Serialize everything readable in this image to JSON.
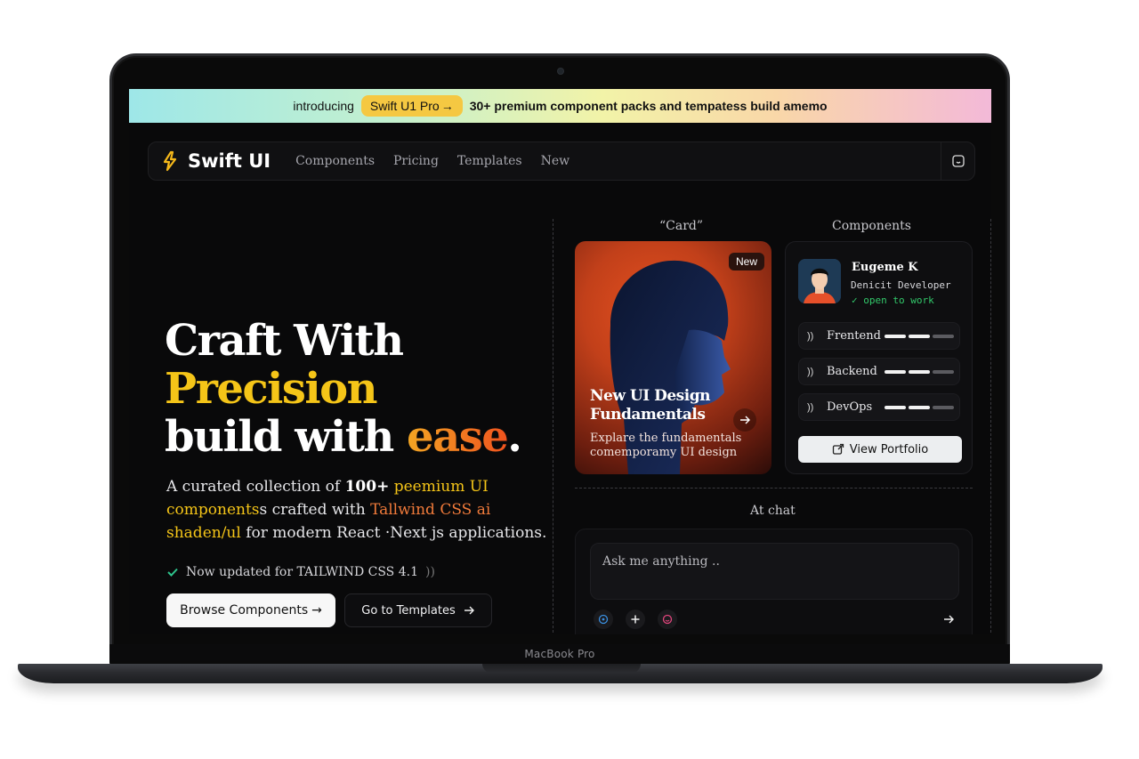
{
  "device": {
    "label": "MacBook Pro"
  },
  "announcement": {
    "prefix": "introducing",
    "pill": "Swift U1 Pro",
    "pill_arrow": "→",
    "text": "30+ premium component packs and tempatess build amemo"
  },
  "nav": {
    "logo": "Swift UI",
    "links": [
      "Components",
      "Pricing",
      "Templates",
      "New"
    ],
    "theme_icon": "theme-toggle-icon"
  },
  "hero": {
    "line1": "Craft With",
    "line2": "Precision",
    "line3a": "build with ",
    "line3b": "ease",
    "line3c": ".",
    "desc": {
      "p1": "A curated collection of ",
      "p2": "100+",
      "p3": " peemium UI",
      "p4": "components",
      "p5": "s crafted with ",
      "p6": "Tallwind CSS ai",
      "p7": "shaden/ul",
      "p8": " for modern React ·Next js applications."
    },
    "updated": "Now updated for TAILWIND CSS 4.1",
    "updated_suffix": "))",
    "browse_btn": "Browse Components",
    "browse_arrow": "→",
    "templates_btn": "Go to Templates"
  },
  "sections": {
    "card_label": "“Card”",
    "components_label": "Components",
    "chat_label": "At chat"
  },
  "card": {
    "badge": "New",
    "title": "New UI Design Fundamentals",
    "subtitle": "Explare the fundamentals comemporamy UI design"
  },
  "profile": {
    "name": "Eugeme K",
    "role": "Denicit Developer",
    "status": "open to work",
    "skills": [
      {
        "name": "Frentend",
        "level": 2,
        "max": 3
      },
      {
        "name": "Backend",
        "level": 2,
        "max": 3
      },
      {
        "name": "DevOps",
        "level": 2,
        "max": 3
      }
    ],
    "view_btn": "View Portfolio"
  },
  "chat": {
    "placeholder": "Ask me anything .."
  },
  "colors": {
    "accent_yellow": "#f5c518",
    "accent_orange": "#f07a3a",
    "status_green": "#32c86a",
    "background": "#09090a"
  }
}
